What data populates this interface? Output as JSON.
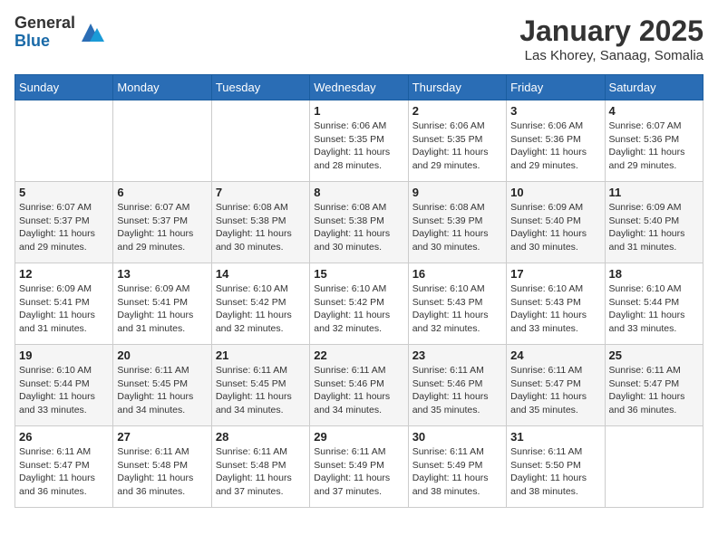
{
  "header": {
    "logo_general": "General",
    "logo_blue": "Blue",
    "month_title": "January 2025",
    "location": "Las Khorey, Sanaag, Somalia"
  },
  "days_of_week": [
    "Sunday",
    "Monday",
    "Tuesday",
    "Wednesday",
    "Thursday",
    "Friday",
    "Saturday"
  ],
  "weeks": [
    [
      {
        "day": "",
        "info": ""
      },
      {
        "day": "",
        "info": ""
      },
      {
        "day": "",
        "info": ""
      },
      {
        "day": "1",
        "info": "Sunrise: 6:06 AM\nSunset: 5:35 PM\nDaylight: 11 hours and 28 minutes."
      },
      {
        "day": "2",
        "info": "Sunrise: 6:06 AM\nSunset: 5:35 PM\nDaylight: 11 hours and 29 minutes."
      },
      {
        "day": "3",
        "info": "Sunrise: 6:06 AM\nSunset: 5:36 PM\nDaylight: 11 hours and 29 minutes."
      },
      {
        "day": "4",
        "info": "Sunrise: 6:07 AM\nSunset: 5:36 PM\nDaylight: 11 hours and 29 minutes."
      }
    ],
    [
      {
        "day": "5",
        "info": "Sunrise: 6:07 AM\nSunset: 5:37 PM\nDaylight: 11 hours and 29 minutes."
      },
      {
        "day": "6",
        "info": "Sunrise: 6:07 AM\nSunset: 5:37 PM\nDaylight: 11 hours and 29 minutes."
      },
      {
        "day": "7",
        "info": "Sunrise: 6:08 AM\nSunset: 5:38 PM\nDaylight: 11 hours and 30 minutes."
      },
      {
        "day": "8",
        "info": "Sunrise: 6:08 AM\nSunset: 5:38 PM\nDaylight: 11 hours and 30 minutes."
      },
      {
        "day": "9",
        "info": "Sunrise: 6:08 AM\nSunset: 5:39 PM\nDaylight: 11 hours and 30 minutes."
      },
      {
        "day": "10",
        "info": "Sunrise: 6:09 AM\nSunset: 5:40 PM\nDaylight: 11 hours and 30 minutes."
      },
      {
        "day": "11",
        "info": "Sunrise: 6:09 AM\nSunset: 5:40 PM\nDaylight: 11 hours and 31 minutes."
      }
    ],
    [
      {
        "day": "12",
        "info": "Sunrise: 6:09 AM\nSunset: 5:41 PM\nDaylight: 11 hours and 31 minutes."
      },
      {
        "day": "13",
        "info": "Sunrise: 6:09 AM\nSunset: 5:41 PM\nDaylight: 11 hours and 31 minutes."
      },
      {
        "day": "14",
        "info": "Sunrise: 6:10 AM\nSunset: 5:42 PM\nDaylight: 11 hours and 32 minutes."
      },
      {
        "day": "15",
        "info": "Sunrise: 6:10 AM\nSunset: 5:42 PM\nDaylight: 11 hours and 32 minutes."
      },
      {
        "day": "16",
        "info": "Sunrise: 6:10 AM\nSunset: 5:43 PM\nDaylight: 11 hours and 32 minutes."
      },
      {
        "day": "17",
        "info": "Sunrise: 6:10 AM\nSunset: 5:43 PM\nDaylight: 11 hours and 33 minutes."
      },
      {
        "day": "18",
        "info": "Sunrise: 6:10 AM\nSunset: 5:44 PM\nDaylight: 11 hours and 33 minutes."
      }
    ],
    [
      {
        "day": "19",
        "info": "Sunrise: 6:10 AM\nSunset: 5:44 PM\nDaylight: 11 hours and 33 minutes."
      },
      {
        "day": "20",
        "info": "Sunrise: 6:11 AM\nSunset: 5:45 PM\nDaylight: 11 hours and 34 minutes."
      },
      {
        "day": "21",
        "info": "Sunrise: 6:11 AM\nSunset: 5:45 PM\nDaylight: 11 hours and 34 minutes."
      },
      {
        "day": "22",
        "info": "Sunrise: 6:11 AM\nSunset: 5:46 PM\nDaylight: 11 hours and 34 minutes."
      },
      {
        "day": "23",
        "info": "Sunrise: 6:11 AM\nSunset: 5:46 PM\nDaylight: 11 hours and 35 minutes."
      },
      {
        "day": "24",
        "info": "Sunrise: 6:11 AM\nSunset: 5:47 PM\nDaylight: 11 hours and 35 minutes."
      },
      {
        "day": "25",
        "info": "Sunrise: 6:11 AM\nSunset: 5:47 PM\nDaylight: 11 hours and 36 minutes."
      }
    ],
    [
      {
        "day": "26",
        "info": "Sunrise: 6:11 AM\nSunset: 5:47 PM\nDaylight: 11 hours and 36 minutes."
      },
      {
        "day": "27",
        "info": "Sunrise: 6:11 AM\nSunset: 5:48 PM\nDaylight: 11 hours and 36 minutes."
      },
      {
        "day": "28",
        "info": "Sunrise: 6:11 AM\nSunset: 5:48 PM\nDaylight: 11 hours and 37 minutes."
      },
      {
        "day": "29",
        "info": "Sunrise: 6:11 AM\nSunset: 5:49 PM\nDaylight: 11 hours and 37 minutes."
      },
      {
        "day": "30",
        "info": "Sunrise: 6:11 AM\nSunset: 5:49 PM\nDaylight: 11 hours and 38 minutes."
      },
      {
        "day": "31",
        "info": "Sunrise: 6:11 AM\nSunset: 5:50 PM\nDaylight: 11 hours and 38 minutes."
      },
      {
        "day": "",
        "info": ""
      }
    ]
  ]
}
